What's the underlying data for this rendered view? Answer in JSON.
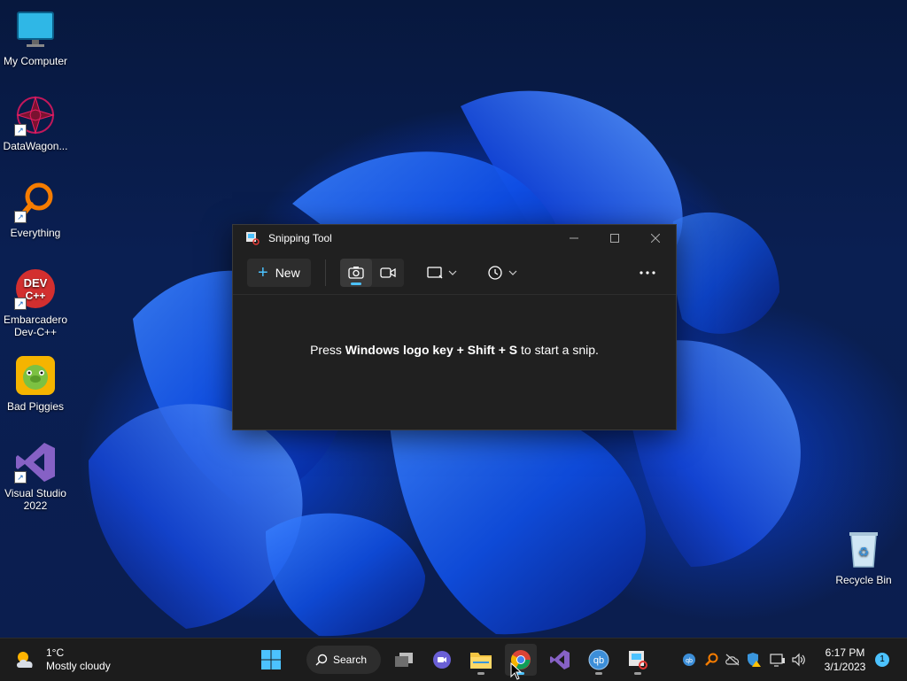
{
  "desktop_icons": [
    {
      "label": "My Computer",
      "icon": "monitor-icon"
    },
    {
      "label": "DataWagon...",
      "icon": "datawagon-icon"
    },
    {
      "label": "Everything",
      "icon": "everything-search-icon"
    },
    {
      "label": "Embarcadero Dev-C++",
      "icon": "devcpp-icon",
      "badge": "DEV C++"
    },
    {
      "label": "Bad Piggies",
      "icon": "bad-piggies-icon"
    },
    {
      "label": "Visual Studio 2022",
      "icon": "visual-studio-icon"
    },
    {
      "label": "Recycle Bin",
      "icon": "recycle-bin-icon"
    }
  ],
  "window": {
    "title": "Snipping Tool",
    "new_label": "New",
    "message_prefix": "Press ",
    "message_bold": "Windows logo key + Shift + S",
    "message_suffix": " to start a snip.",
    "accent": "#4cc2ff"
  },
  "taskbar": {
    "weather_temp": "1°C",
    "weather_desc": "Mostly cloudy",
    "search_label": "Search",
    "time": "6:17 PM",
    "date": "3/1/2023",
    "notification_count": "1"
  }
}
